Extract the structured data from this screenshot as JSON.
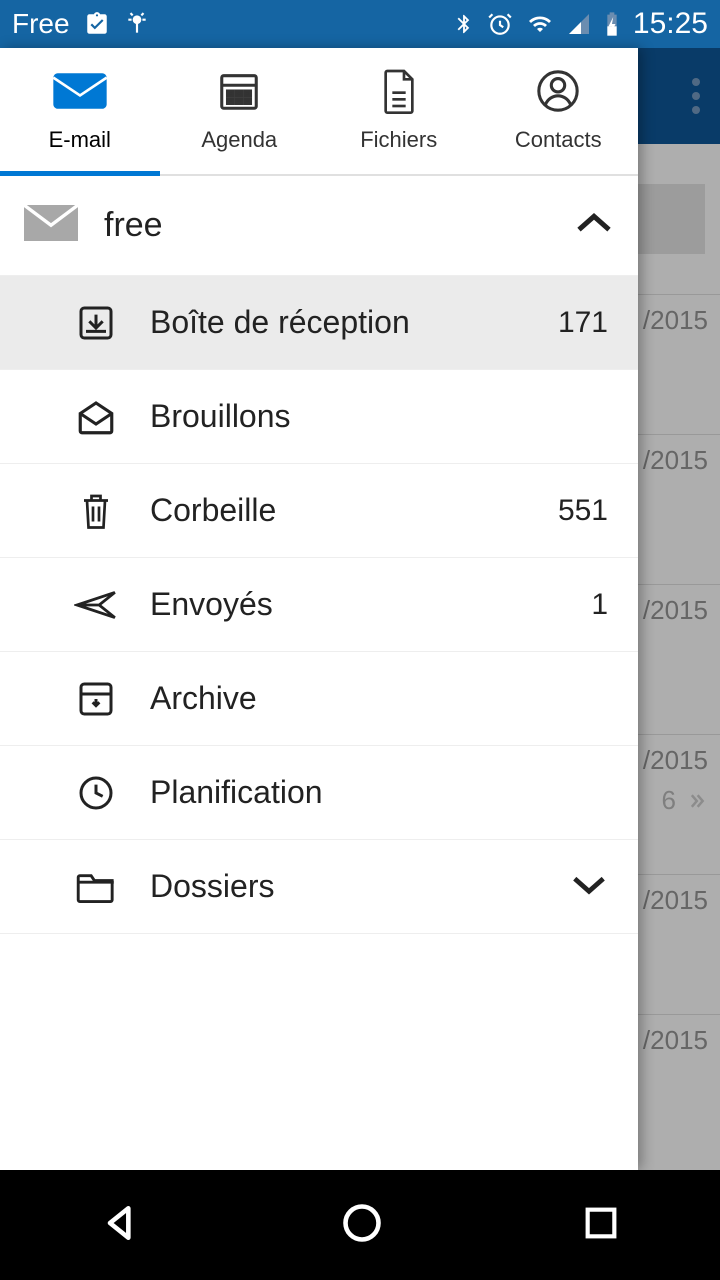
{
  "status": {
    "carrier": "Free",
    "time": "15:25"
  },
  "tabs": {
    "email": "E-mail",
    "agenda": "Agenda",
    "files": "Fichiers",
    "contacts": "Contacts"
  },
  "account": {
    "name": "free"
  },
  "folders": {
    "inbox": {
      "label": "Boîte de réception",
      "count": "171"
    },
    "drafts": {
      "label": "Brouillons"
    },
    "trash": {
      "label": "Corbeille",
      "count": "551"
    },
    "sent": {
      "label": "Envoyés",
      "count": "1"
    },
    "archive": {
      "label": "Archive"
    },
    "scheduled": {
      "label": "Planification"
    },
    "folders": {
      "label": "Dossiers"
    }
  },
  "background": {
    "date1": "/2015",
    "date2": "/2015",
    "date3": "/2015",
    "date4": "/2015",
    "date5": "/2015",
    "date6": "/2015",
    "extra6": "6"
  }
}
